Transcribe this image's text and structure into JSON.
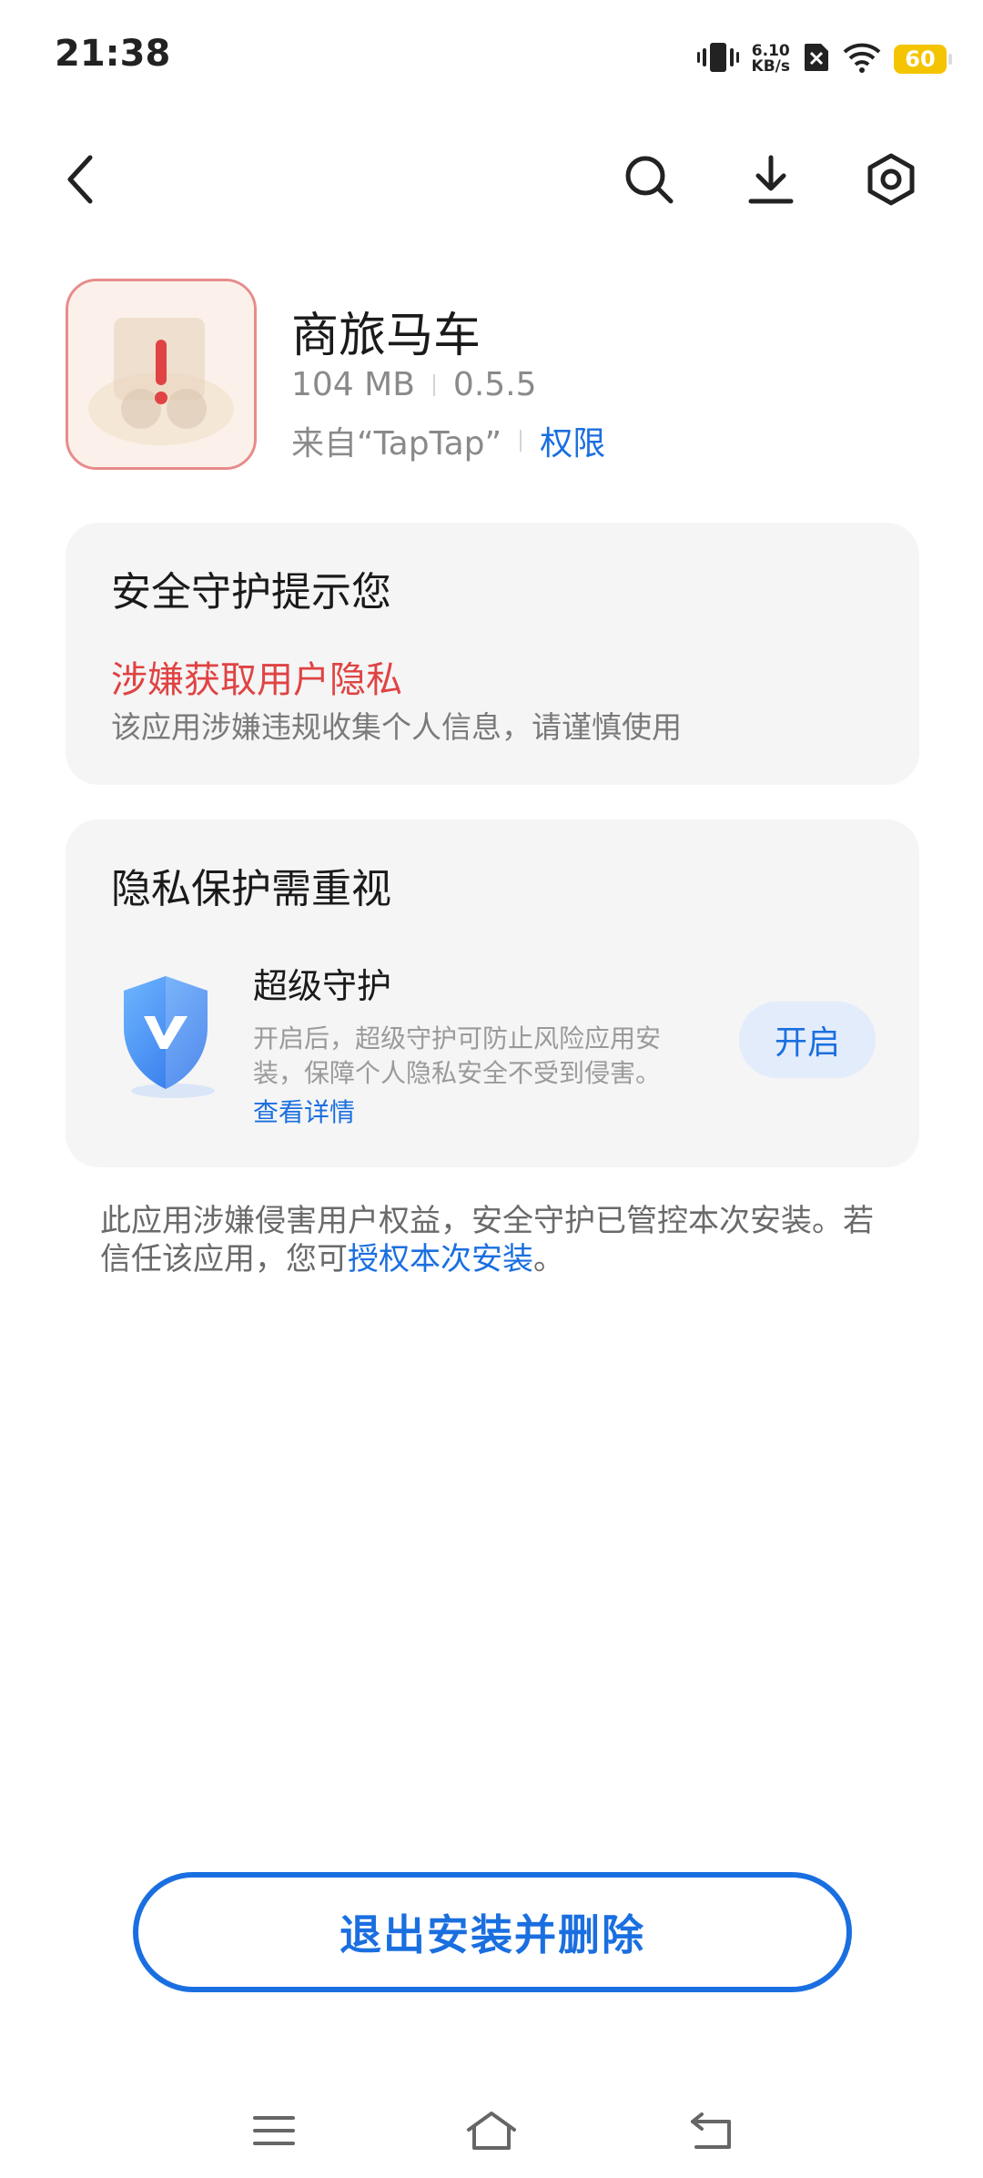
{
  "status_bar": {
    "time": "21:38",
    "net_speed_value": "6.10",
    "net_speed_unit": "KB/s",
    "battery": "60",
    "icons": [
      "vibrate-icon",
      "no-sim-icon",
      "wifi-icon",
      "battery-icon"
    ]
  },
  "header": {
    "icons": [
      "back-icon",
      "search-icon",
      "download-icon",
      "settings-icon"
    ]
  },
  "app": {
    "name": "商旅马车",
    "size": "104 MB",
    "version": "0.5.5",
    "source": "来自“TapTap”",
    "permissions_link": "权限",
    "icon_warning": "!"
  },
  "security_card": {
    "title": "安全守护提示您",
    "risk_title": "涉嫌获取用户隐私",
    "risk_desc": "该应用涉嫌违规收集个人信息，请谨慎使用"
  },
  "privacy_card": {
    "title": "隐私保护需重视",
    "protection_title": "超级守护",
    "protection_desc": "开启后，超级守护可防止风险应用安装，保障个人隐私安全不受到侵害。",
    "details_link": "查看详情",
    "enable_button": "开启"
  },
  "notice": {
    "text_before": "此应用涉嫌侵害用户权益，安全守护已管控本次安装。若信任该应用，您可",
    "link": "授权本次安装",
    "text_after": "。"
  },
  "exit_button": "退出安装并删除",
  "colors": {
    "accent": "#1a6fe0",
    "danger": "#e04343",
    "card_bg": "#f5f5f5"
  }
}
